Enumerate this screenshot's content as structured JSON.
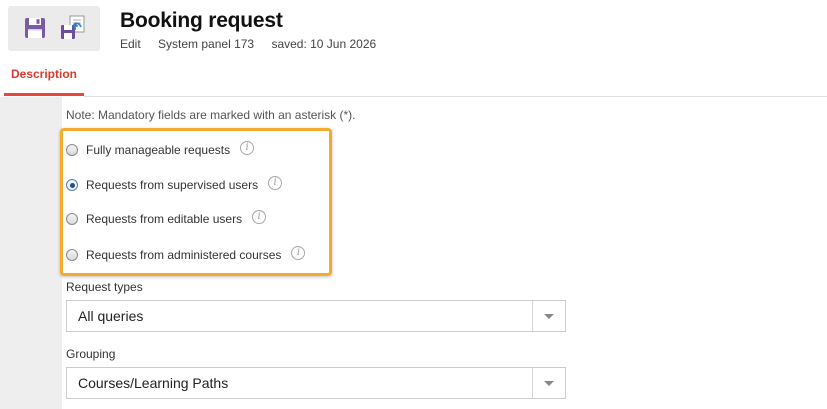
{
  "header": {
    "title": "Booking request",
    "meta": {
      "mode": "Edit",
      "panel": "System panel 173",
      "saved": "saved: 10 Jun 2026"
    }
  },
  "toolbar": {
    "save_icon": "floppy-disk-icon",
    "save_as_icon": "save-as-icon",
    "accent_color": "#7b5aa6"
  },
  "tabs": [
    {
      "label": "Description",
      "active": true
    }
  ],
  "form": {
    "note": "Note: Mandatory fields are marked with an asterisk (*).",
    "scope_options": [
      {
        "label": "Fully manageable requests",
        "checked": false
      },
      {
        "label": "Requests from supervised users",
        "checked": true
      },
      {
        "label": "Requests from editable users",
        "checked": false
      },
      {
        "label": "Requests from administered courses",
        "checked": false
      }
    ],
    "request_types": {
      "label": "Request types",
      "value": "All queries"
    },
    "grouping": {
      "label": "Grouping",
      "value": "Courses/Learning Paths"
    }
  },
  "colors": {
    "tab_active": "#e8483b",
    "highlight_border": "#f2ab2c"
  }
}
